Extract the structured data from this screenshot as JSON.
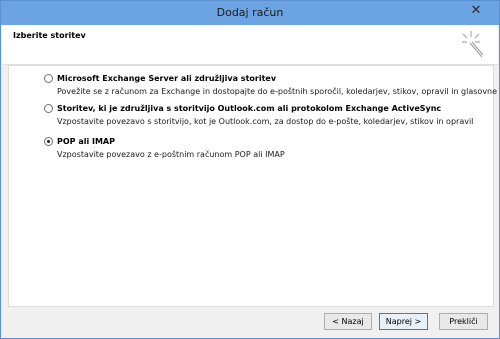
{
  "window": {
    "title": "Dodaj račun",
    "close_symbol": "✕"
  },
  "header": {
    "title": "Izberite storitev",
    "icon": "wizard-sparkle-icon"
  },
  "options": [
    {
      "label": "Microsoft Exchange Server ali združljiva storitev",
      "description": "Povežite se z računom za Exchange in dostopajte do e-poštnih sporočil, koledarjev, stikov, opravil in glasovne pošte",
      "selected": false
    },
    {
      "label": "Storitev, ki je združljiva s storitvijo Outlook.com ali protokolom Exchange ActiveSync",
      "description": "Vzpostavite povezavo s storitvijo, kot je Outlook.com, za dostop do e-pošte, koledarjev, stikov in opravil",
      "selected": false
    },
    {
      "label": "POP ali IMAP",
      "description": "Vzpostavite povezavo z e-poštnim računom POP ali IMAP",
      "selected": true
    }
  ],
  "buttons": {
    "back": "< Nazaj",
    "next": "Naprej >",
    "cancel": "Prekliči"
  },
  "colors": {
    "titlebar": "#6ca4e3",
    "window_border": "#5a8fd0",
    "dialog_background": "#f0f0f0"
  }
}
